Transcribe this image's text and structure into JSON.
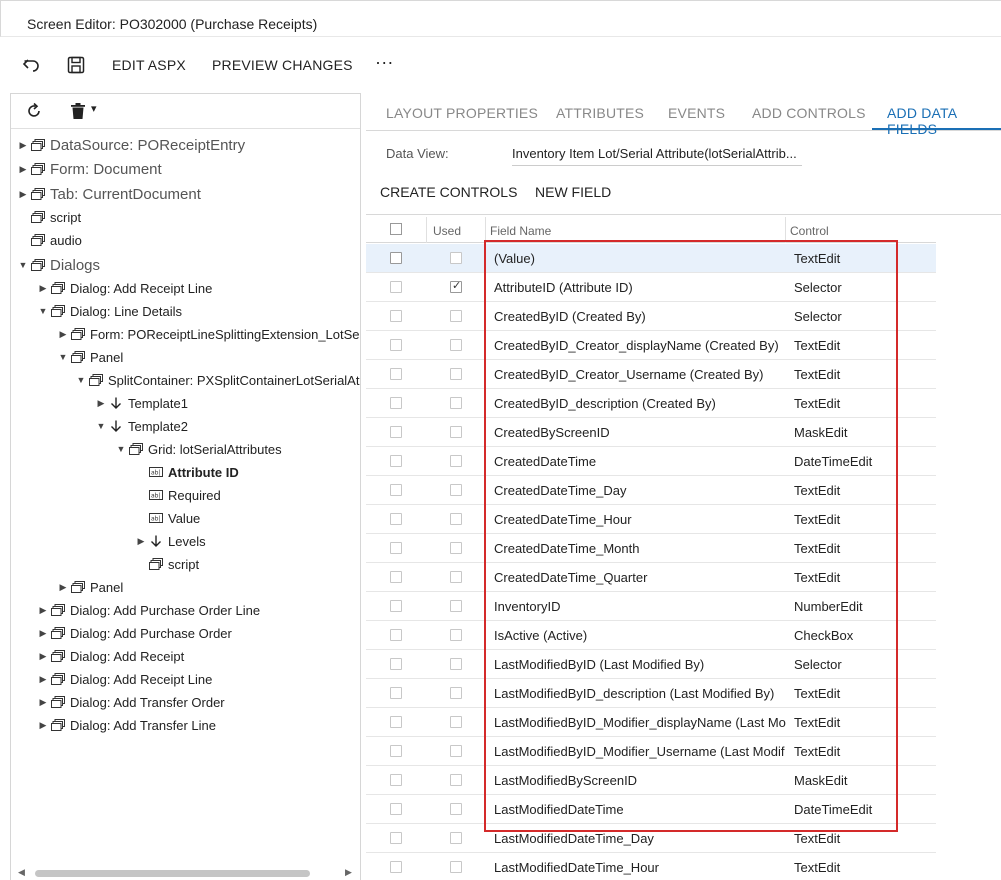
{
  "title": "Screen Editor: PO302000 (Purchase Receipts)",
  "toolbar": {
    "undo_icon": "undo-icon",
    "save_icon": "save-icon",
    "edit_aspx": "EDIT ASPX",
    "preview_changes": "PREVIEW CHANGES",
    "more": "···"
  },
  "left_toolbar": {
    "refresh_icon": "refresh-icon",
    "delete_icon": "trash-icon",
    "dropdown": "▾"
  },
  "tree": [
    "DataSource: POReceiptEntry",
    "Form: Document",
    "Tab: CurrentDocument",
    "script",
    "audio",
    "Dialogs",
    "Dialog: Add Receipt Line",
    "Dialog: Line Details",
    "Form: POReceiptLineSplittingExtension_LotSe",
    "Panel",
    "SplitContainer: PXSplitContainerLotSerialAt",
    "Template1",
    "Template2",
    "Grid: lotSerialAttributes",
    "Attribute ID",
    "Required",
    "Value",
    "Levels",
    "script",
    "Panel",
    "Dialog: Add Purchase Order Line",
    "Dialog: Add Purchase Order",
    "Dialog: Add Receipt",
    "Dialog: Add Receipt Line",
    "Dialog: Add Transfer Order",
    "Dialog: Add Transfer Line"
  ],
  "tabs": [
    "LAYOUT PROPERTIES",
    "ATTRIBUTES",
    "EVENTS",
    "ADD CONTROLS",
    "ADD DATA FIELDS"
  ],
  "active_tab": "ADD DATA FIELDS",
  "data_view": {
    "label": "Data View:",
    "value": "Inventory Item Lot/Serial Attribute(lotSerialAttrib..."
  },
  "actions": {
    "create_controls": "CREATE CONTROLS",
    "new_field": "NEW FIELD"
  },
  "grid": {
    "headers": {
      "used": "Used",
      "field_name": "Field Name",
      "control": "Control"
    },
    "rows": [
      {
        "field": "(Value)",
        "control": "TextEdit",
        "used": false
      },
      {
        "field": "AttributeID (Attribute ID)",
        "control": "Selector",
        "used": true
      },
      {
        "field": "CreatedByID (Created By)",
        "control": "Selector",
        "used": false
      },
      {
        "field": "CreatedByID_Creator_displayName (Created By)",
        "control": "TextEdit",
        "used": false
      },
      {
        "field": "CreatedByID_Creator_Username (Created By)",
        "control": "TextEdit",
        "used": false
      },
      {
        "field": "CreatedByID_description (Created By)",
        "control": "TextEdit",
        "used": false
      },
      {
        "field": "CreatedByScreenID",
        "control": "MaskEdit",
        "used": false
      },
      {
        "field": "CreatedDateTime",
        "control": "DateTimeEdit",
        "used": false
      },
      {
        "field": "CreatedDateTime_Day",
        "control": "TextEdit",
        "used": false
      },
      {
        "field": "CreatedDateTime_Hour",
        "control": "TextEdit",
        "used": false
      },
      {
        "field": "CreatedDateTime_Month",
        "control": "TextEdit",
        "used": false
      },
      {
        "field": "CreatedDateTime_Quarter",
        "control": "TextEdit",
        "used": false
      },
      {
        "field": "InventoryID",
        "control": "NumberEdit",
        "used": false
      },
      {
        "field": "IsActive (Active)",
        "control": "CheckBox",
        "used": false
      },
      {
        "field": "LastModifiedByID (Last Modified By)",
        "control": "Selector",
        "used": false
      },
      {
        "field": "LastModifiedByID_description (Last Modified By)",
        "control": "TextEdit",
        "used": false
      },
      {
        "field": "LastModifiedByID_Modifier_displayName (Last Mo",
        "control": "TextEdit",
        "used": false
      },
      {
        "field": "LastModifiedByID_Modifier_Username (Last Modif",
        "control": "TextEdit",
        "used": false
      },
      {
        "field": "LastModifiedByScreenID",
        "control": "MaskEdit",
        "used": false
      },
      {
        "field": "LastModifiedDateTime",
        "control": "DateTimeEdit",
        "used": false
      },
      {
        "field": "LastModifiedDateTime_Day",
        "control": "TextEdit",
        "used": false
      },
      {
        "field": "LastModifiedDateTime_Hour",
        "control": "TextEdit",
        "used": false
      }
    ]
  },
  "colors": {
    "accent": "#1a6fb5",
    "highlight_border": "#d42a2a",
    "selected_row": "#e8f1fb"
  }
}
